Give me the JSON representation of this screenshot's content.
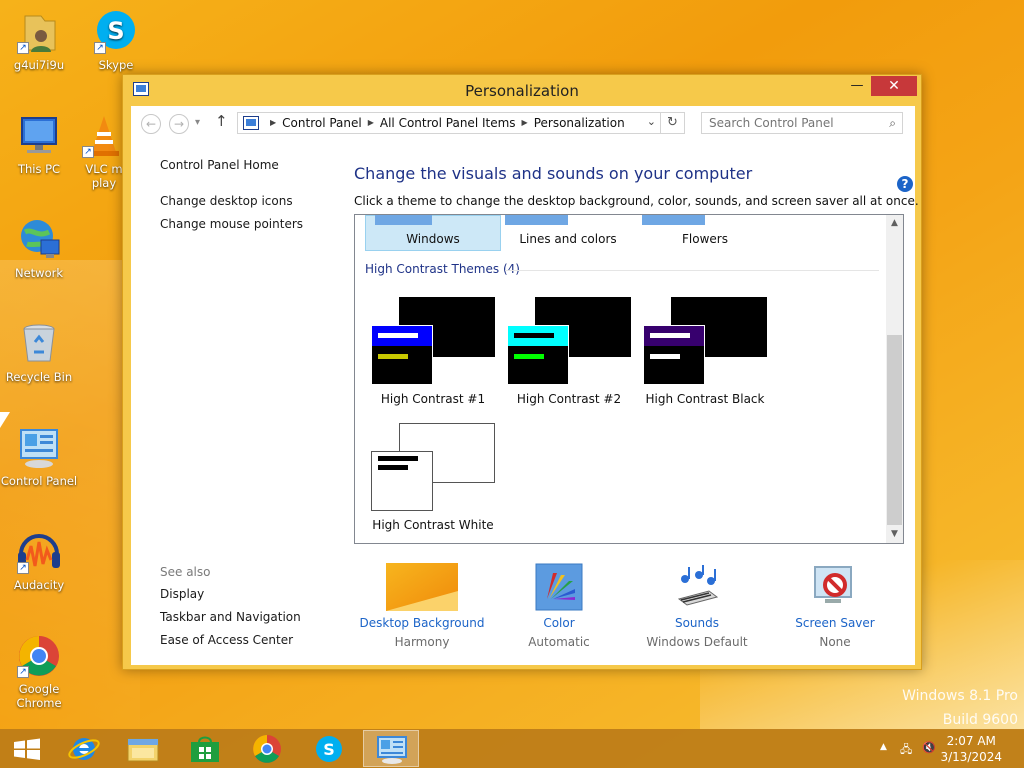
{
  "desktop": {
    "icons": [
      {
        "name": "desktop-icon-user-folder",
        "label": "g4ui7i9u",
        "icon": "user-folder-icon"
      },
      {
        "name": "desktop-icon-skype",
        "label": "Skype",
        "icon": "skype-icon"
      },
      {
        "name": "desktop-icon-this-pc",
        "label": "This PC",
        "icon": "computer-icon"
      },
      {
        "name": "desktop-icon-vlc",
        "label": "VLC m play",
        "icon": "vlc-cone-icon"
      },
      {
        "name": "desktop-icon-network",
        "label": "Network",
        "icon": "network-globe-icon"
      },
      {
        "name": "desktop-icon-recycle-bin",
        "label": "Recycle Bin",
        "icon": "recycle-bin-icon"
      },
      {
        "name": "desktop-icon-control-panel",
        "label": "Control Panel",
        "icon": "control-panel-icon"
      },
      {
        "name": "desktop-icon-audacity",
        "label": "Audacity",
        "icon": "audacity-icon"
      },
      {
        "name": "desktop-icon-google-chrome",
        "label": "Google Chrome",
        "icon": "chrome-icon"
      }
    ]
  },
  "window": {
    "title": "Personalization",
    "controls": {
      "minimize": "—",
      "maximize": "☐",
      "close": "✕"
    }
  },
  "address": {
    "crumbs": [
      "Control Panel",
      "All Control Panel Items",
      "Personalization"
    ],
    "search_placeholder": "Search Control Panel"
  },
  "left_nav": {
    "home": "Control Panel Home",
    "links": [
      "Change desktop icons",
      "Change mouse pointers"
    ],
    "see_also_title": "See also",
    "see_also": [
      "Display",
      "Taskbar and Navigation",
      "Ease of Access Center"
    ]
  },
  "main": {
    "heading": "Change the visuals and sounds on your computer",
    "subheading": "Click a theme to change the desktop background, color, sounds, and screen saver all at once.",
    "top_themes": [
      "Windows",
      "Lines and colors",
      "Flowers"
    ],
    "selected_theme": "Windows",
    "hc_group_title": "High Contrast Themes (4)",
    "hc_themes": [
      {
        "label": "High Contrast #1",
        "title_bar": "#0000ff",
        "line1": "#ffffff",
        "line2": "#c8c800"
      },
      {
        "label": "High Contrast #2",
        "title_bar": "#00ffff",
        "line1": "#000000",
        "line2": "#00ff00"
      },
      {
        "label": "High Contrast Black",
        "title_bar": "#37006e",
        "line1": "#ffffff",
        "line2": "#ffffff"
      },
      {
        "label": "High Contrast White",
        "title_bar": "#ffffff",
        "line1": "#000000",
        "line2": "#000000"
      }
    ]
  },
  "bottom": [
    {
      "label": "Desktop Background",
      "value": "Harmony",
      "icon": "desktop-background-icon"
    },
    {
      "label": "Color",
      "value": "Automatic",
      "icon": "color-palette-icon"
    },
    {
      "label": "Sounds",
      "value": "Windows Default",
      "icon": "sounds-music-notes-icon"
    },
    {
      "label": "Screen Saver",
      "value": "None",
      "icon": "screen-saver-icon"
    }
  ],
  "watermark": {
    "line1": "Windows 8.1 Pro",
    "line2": "Build 9600"
  },
  "taskbar": {
    "apps": [
      "start-icon",
      "internet-explorer-icon",
      "file-explorer-icon",
      "store-icon",
      "chrome-icon",
      "skype-icon",
      "control-panel-icon"
    ],
    "active_app": "control-panel-icon",
    "time": "2:07 AM",
    "date": "3/13/2024"
  }
}
